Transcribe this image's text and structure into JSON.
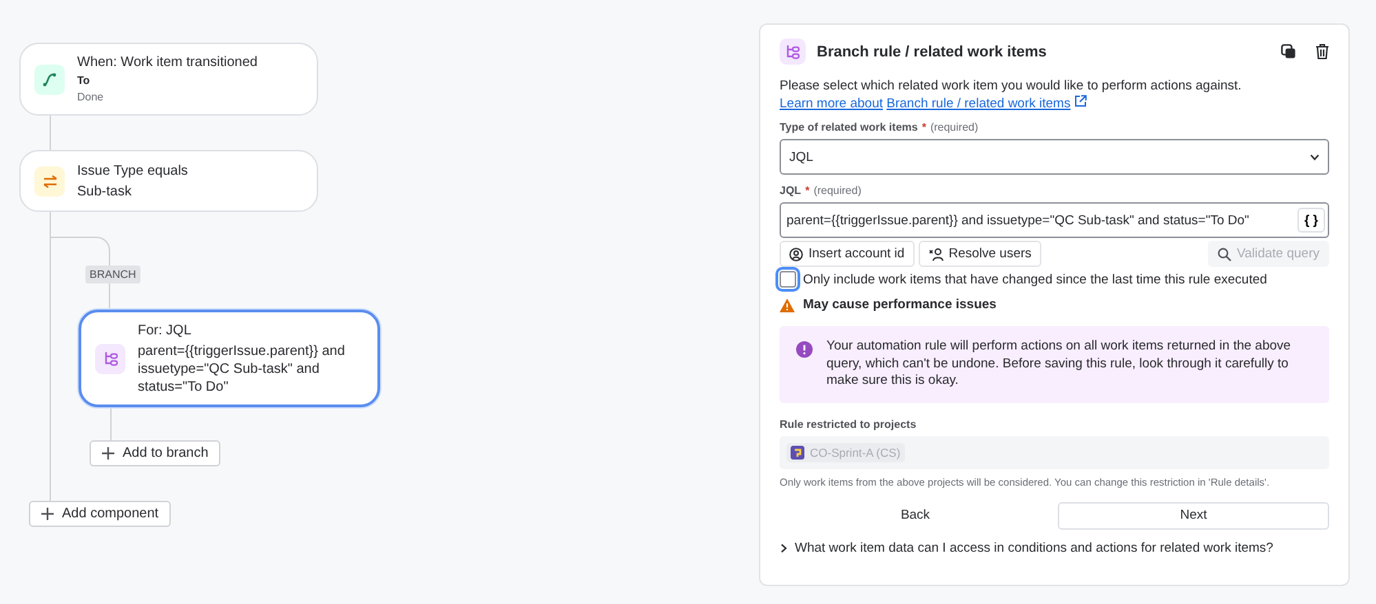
{
  "canvas": {
    "nodes": [
      {
        "kind": "trigger",
        "title": "When: Work item transitioned",
        "label": "To",
        "value": "Done",
        "selected": false
      },
      {
        "kind": "condition",
        "title": "Issue Type equals",
        "value": "Sub-task",
        "selected": false
      },
      {
        "kind": "branch",
        "title": "For: JQL",
        "value": "parent={{triggerIssue.parent}} and issuetype=\"QC Sub-task\" and status=\"To Do\"",
        "selected": true
      }
    ],
    "branch_tag": "BRANCH",
    "add_to_branch": "Add to branch",
    "add_component": "Add component"
  },
  "panel": {
    "title": "Branch rule / related work items",
    "intro": "Please select which related work item you would like to perform actions against.",
    "intro_link": [
      "Learn more about",
      "Branch rule / related work items"
    ],
    "type_label": "Type of related work items",
    "required_mark": "*",
    "required_note": "(required)",
    "type_value": "JQL",
    "jql_label": "JQL",
    "jql_required_mark": "*",
    "jql_required_note": "(required)",
    "jql_value": "parent={{triggerIssue.parent}} and issuetype=\"QC Sub-task\" and status=\"To Do\"",
    "smart_values": "{ }",
    "actions": [
      {
        "kind": "account",
        "label": "Insert account id",
        "disabled": false
      },
      {
        "kind": "users",
        "label": "Resolve users",
        "disabled": false
      },
      {
        "kind": "validate",
        "label": "Validate query",
        "disabled": true
      }
    ],
    "only_changed": {
      "label": "Only include work items that have changed since the last time this rule executed",
      "checked": false
    },
    "warning": "May cause performance issues",
    "notice": "Your automation rule will perform actions on all work items returned in the above query, which can't be undone. Before saving this rule, look through it carefully to make sure this is okay.",
    "projects_label": "Rule restricted to projects",
    "project": "CO-Sprint-A (CS)",
    "projects_help": "Only work items from the above projects will be considered. You can change this restriction in 'Rule details'.",
    "back": "Back",
    "next": "Next",
    "faq": {
      "label": "What work item data can I access in conditions and actions for related work items?",
      "expanded": false
    }
  }
}
